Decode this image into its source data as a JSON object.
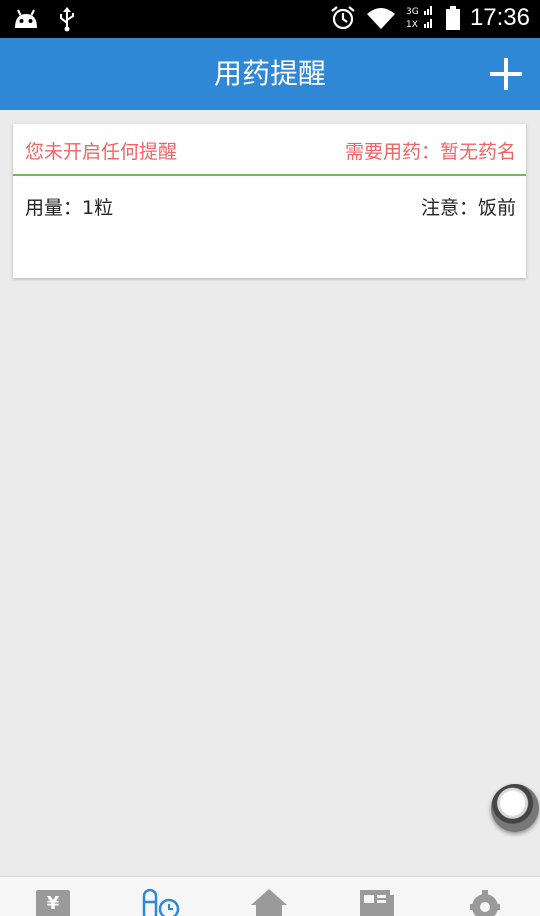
{
  "status_bar": {
    "time": "17:36",
    "left_icons": [
      "android-icon",
      "usb-icon"
    ],
    "right_icons": [
      "alarm-icon",
      "wifi-icon",
      "signal-3g-icon",
      "battery-icon"
    ],
    "network_labels": [
      "3G",
      "1X"
    ]
  },
  "app_bar": {
    "title": "用药提醒",
    "add_icon": "plus-icon",
    "color": "#2e88d5"
  },
  "reminder_card": {
    "status_text": "您未开启任何提醒",
    "medicine_text": "需要用药：暂无药名",
    "dosage_text": "用量：1粒",
    "note_text": "注意：饭前",
    "alert_color": "#f06464",
    "divider_color": "#6cc04a"
  },
  "floating_button": {
    "icon": "assistive-touch-icon"
  },
  "bottom_nav": {
    "items": [
      {
        "icon": "yen-icon"
      },
      {
        "icon": "medicine-clock-icon",
        "active": true
      },
      {
        "icon": "home-icon"
      },
      {
        "icon": "news-icon"
      },
      {
        "icon": "gear-icon"
      }
    ],
    "active_color": "#2e88d5",
    "inactive_color": "#9a9a9a"
  }
}
